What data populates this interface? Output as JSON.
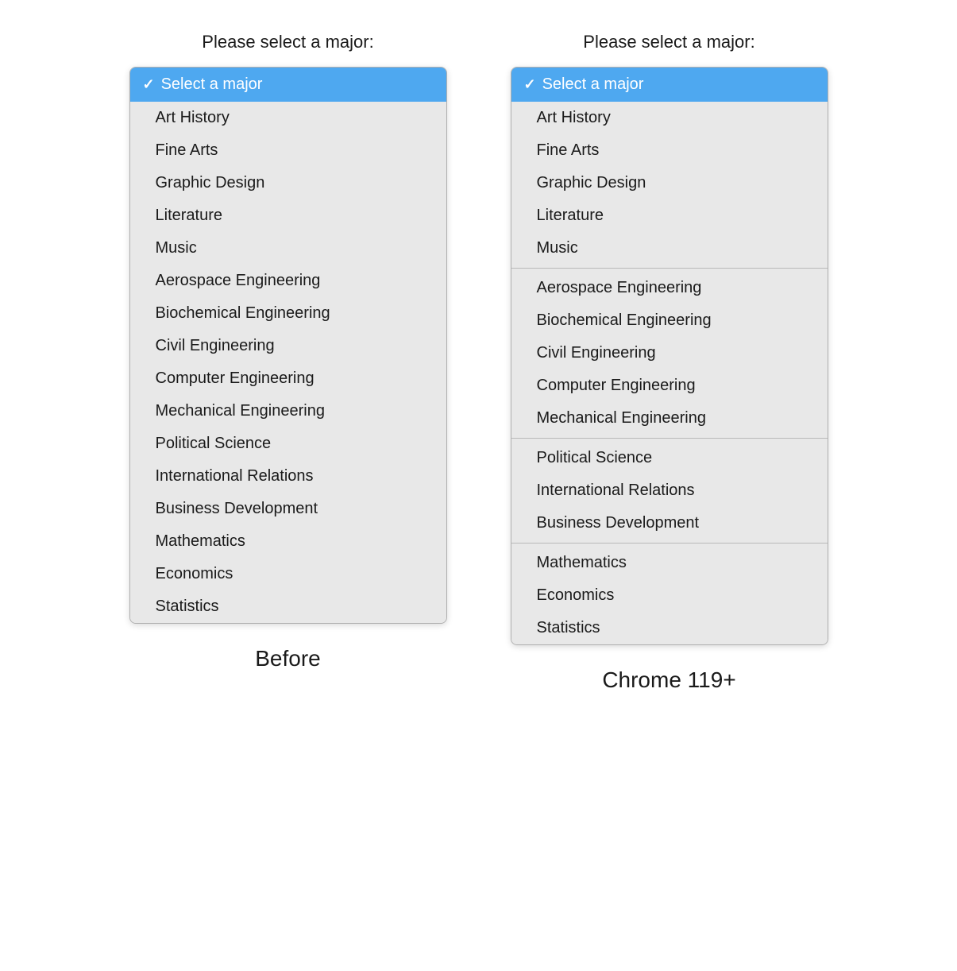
{
  "before": {
    "label": "Please select a major:",
    "selected": "Select a major",
    "caption": "Before",
    "items": [
      {
        "label": "Art History"
      },
      {
        "label": "Fine Arts"
      },
      {
        "label": "Graphic Design"
      },
      {
        "label": "Literature"
      },
      {
        "label": "Music"
      },
      {
        "label": "Aerospace Engineering"
      },
      {
        "label": "Biochemical Engineering"
      },
      {
        "label": "Civil Engineering"
      },
      {
        "label": "Computer Engineering"
      },
      {
        "label": "Mechanical Engineering"
      },
      {
        "label": "Political Science"
      },
      {
        "label": "International Relations"
      },
      {
        "label": "Business Development"
      },
      {
        "label": "Mathematics"
      },
      {
        "label": "Economics"
      },
      {
        "label": "Statistics"
      }
    ]
  },
  "after": {
    "label": "Please select a major:",
    "selected": "Select a major",
    "caption": "Chrome 119+",
    "groups": [
      {
        "items": [
          {
            "label": "Art History"
          },
          {
            "label": "Fine Arts"
          },
          {
            "label": "Graphic Design"
          },
          {
            "label": "Literature"
          },
          {
            "label": "Music"
          }
        ]
      },
      {
        "items": [
          {
            "label": "Aerospace Engineering"
          },
          {
            "label": "Biochemical Engineering"
          },
          {
            "label": "Civil Engineering"
          },
          {
            "label": "Computer Engineering"
          },
          {
            "label": "Mechanical Engineering"
          }
        ]
      },
      {
        "items": [
          {
            "label": "Political Science"
          },
          {
            "label": "International Relations"
          },
          {
            "label": "Business Development"
          }
        ]
      },
      {
        "items": [
          {
            "label": "Mathematics"
          },
          {
            "label": "Economics"
          },
          {
            "label": "Statistics"
          }
        ]
      }
    ]
  }
}
